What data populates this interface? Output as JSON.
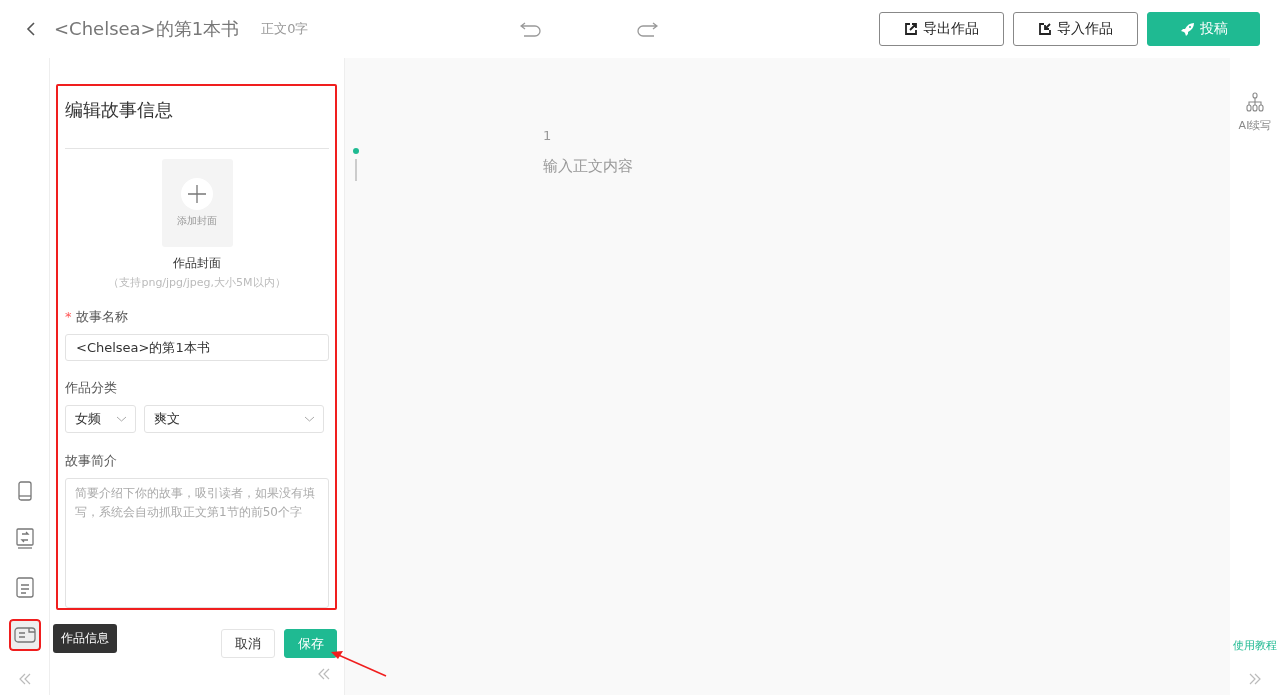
{
  "header": {
    "title": "<Chelsea>的第1本书",
    "word_count": "正文0字",
    "buttons": [
      {
        "label": "导出作品",
        "kind": "export"
      },
      {
        "label": "导入作品",
        "kind": "import"
      },
      {
        "label": "投稿",
        "kind": "submit"
      }
    ]
  },
  "rail": {
    "items": [
      {
        "kind": "phone",
        "selected": false
      },
      {
        "kind": "swap",
        "selected": false
      },
      {
        "kind": "doc",
        "selected": false
      },
      {
        "kind": "info",
        "selected": true,
        "tooltip": "作品信息"
      }
    ]
  },
  "panel": {
    "title": "编辑故事信息",
    "cover": {
      "add_label": "添加封面",
      "label": "作品封面",
      "hint": "（支持png/jpg/jpeg,大小5M以内）"
    },
    "name_field": {
      "label": "故事名称",
      "required_mark": "*",
      "value": "<Chelsea>的第1本书"
    },
    "category": {
      "label": "作品分类",
      "selects": [
        "女频",
        "爽文"
      ]
    },
    "intro": {
      "label": "故事简介",
      "placeholder": "简要介绍下你的故事，吸引读者，如果没有填写，系统会自动抓取正文第1节的前50个字"
    },
    "buttons": [
      {
        "label": "取消",
        "kind": "secondary"
      },
      {
        "label": "保存",
        "kind": "primary"
      }
    ]
  },
  "editor": {
    "chapter_number": "1",
    "placeholder": "输入正文内容"
  },
  "right_rail": {
    "tool": "AI续写",
    "help_link": "使用教程"
  }
}
